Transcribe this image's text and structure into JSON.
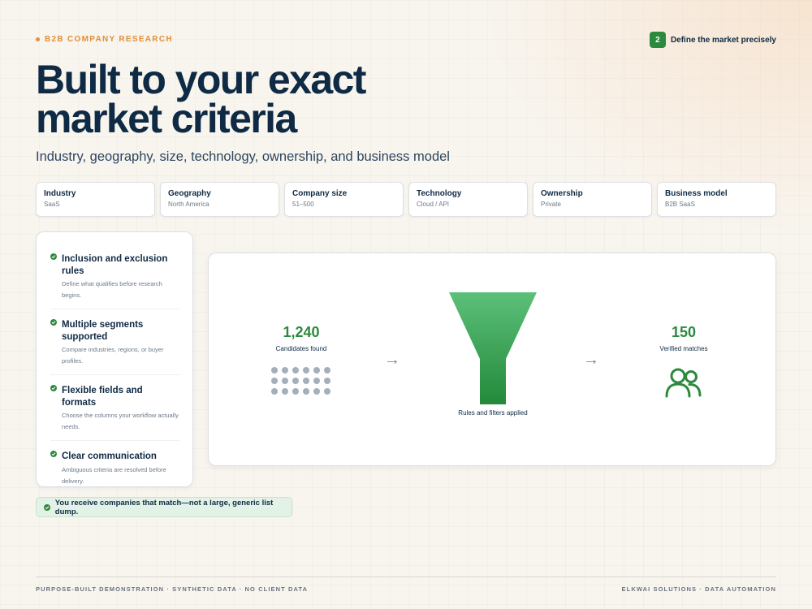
{
  "header": {
    "eyebrow": "B2B COMPANY RESEARCH",
    "step_number": "2",
    "step_label": "Define the market precisely"
  },
  "hero": {
    "title_line1": "Built to your exact",
    "title_line2": "market criteria",
    "subtitle": "Industry, geography, size, technology, ownership, and business model"
  },
  "criteria": [
    {
      "label": "Industry",
      "value": "SaaS"
    },
    {
      "label": "Geography",
      "value": "North America"
    },
    {
      "label": "Company size",
      "value": "51–500"
    },
    {
      "label": "Technology",
      "value": "Cloud / API"
    },
    {
      "label": "Ownership",
      "value": "Private"
    },
    {
      "label": "Business model",
      "value": "B2B SaaS"
    }
  ],
  "features": [
    {
      "title": "Inclusion and exclusion rules",
      "description": "Define what qualifies before research begins."
    },
    {
      "title": "Multiple segments supported",
      "description": "Compare industries, regions, or buyer profiles."
    },
    {
      "title": "Flexible fields and formats",
      "description": "Choose the columns your workflow actually needs."
    },
    {
      "title": "Clear communication",
      "description": "Ambiguous criteria are resolved before delivery."
    }
  ],
  "funnel": {
    "candidates_value": "1,240",
    "candidates_label": "Candidates found",
    "filter_caption": "Rules and filters applied",
    "verified_value": "150",
    "verified_label": "Verified matches",
    "arrow_glyph": "→"
  },
  "callout": {
    "text": "You receive companies that match—not a large, generic list dump."
  },
  "footer": {
    "left": "PURPOSE-BUILT DEMONSTRATION · SYNTHETIC DATA · NO CLIENT DATA",
    "right": "ELKWAI SOLUTIONS · DATA AUTOMATION"
  },
  "colors": {
    "accent_green": "#2b8a3e",
    "accent_orange": "#e0903a",
    "navy": "#0f2a44"
  },
  "icons": {
    "eyebrow": "dot-icon",
    "feature": "check-circle-icon",
    "verified": "people-icon"
  }
}
